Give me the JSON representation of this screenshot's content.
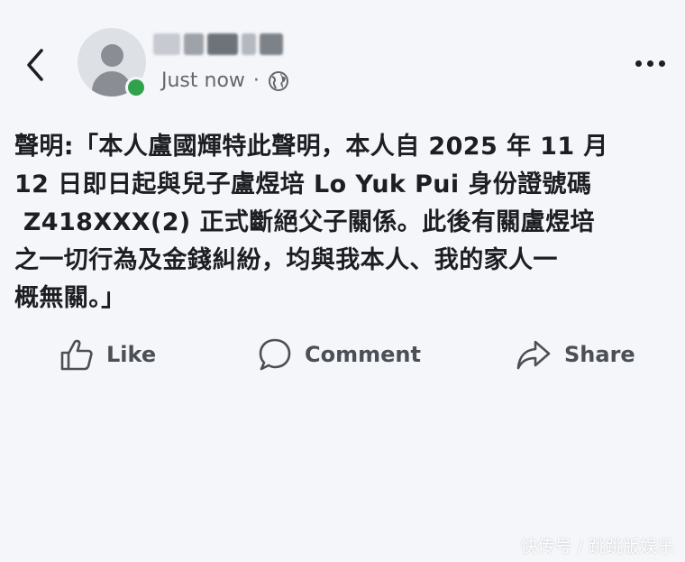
{
  "header": {
    "time_label": "Just now",
    "separator": "·",
    "privacy_icon": "globe-icon",
    "back_icon": "chevron-left-icon",
    "more_icon": "more-dots-icon",
    "online_color": "#31a24c"
  },
  "post": {
    "text": "聲明:「本人盧國輝特此聲明，本人自 2025 年 11 月\n12 日即日起與兒子盧煜培 Lo Yuk Pui 身份證號碼\n Z418XXX(2) 正式斷絕父子關係。此後有關盧煜培\n之一切行為及金錢糾紛，均與我本人、我的家人一\n概無關。」"
  },
  "actions": {
    "like": {
      "label": "Like",
      "icon": "thumbs-up-icon"
    },
    "comment": {
      "label": "Comment",
      "icon": "comment-bubble-icon"
    },
    "share": {
      "label": "Share",
      "icon": "share-arrow-icon"
    }
  },
  "watermark": "快传号 / 跳跳版娱乐"
}
